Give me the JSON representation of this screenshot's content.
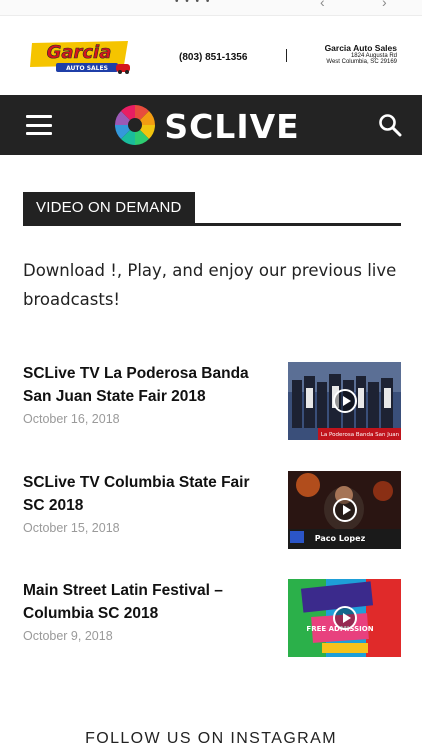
{
  "ad": {
    "brand_name": "Garcia",
    "brand_sub": "AUTO SALES",
    "phone": "(803) 851-1356",
    "business_name": "Garcia Auto Sales",
    "address_line1": "1824 Augusta Rd",
    "address_line2": "West Columbia, SC 29169"
  },
  "header": {
    "logo_text": "SCLIVE"
  },
  "section": {
    "title": "VIDEO ON DEMAND",
    "intro": "Download !, Play, and enjoy our previous live broadcasts!"
  },
  "posts": [
    {
      "title": "SCLive TV La Poderosa Banda San Juan State Fair 2018",
      "date": "October 16, 2018",
      "thumb_caption": "La Poderosa Banda San Juan"
    },
    {
      "title": "SCLive TV Columbia State Fair SC 2018",
      "date": "October 15, 2018",
      "thumb_caption": "Paco Lopez"
    },
    {
      "title": "Main Street Latin Festival – Columbia SC 2018",
      "date": "October 9, 2018",
      "thumb_caption": "FREE ADMISSION"
    }
  ],
  "footer": {
    "instagram_heading": "FOLLOW US ON INSTAGRAM"
  },
  "colors": {
    "header_bg": "#232323",
    "accent_red": "#e01b24",
    "date_gray": "#9a9a9a"
  }
}
